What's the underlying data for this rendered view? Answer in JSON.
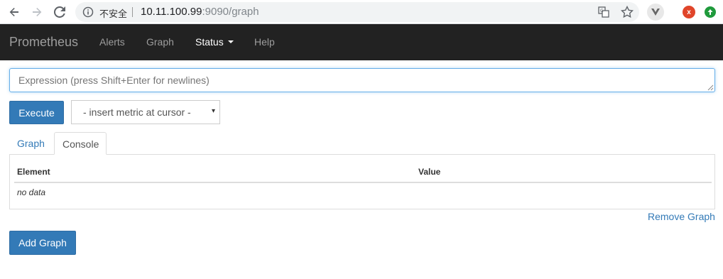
{
  "browser": {
    "insecure_label": "不安全",
    "url_host": "10.11.100.99",
    "url_path": ":9090/graph",
    "ext_x_label": "x"
  },
  "navbar": {
    "brand": "Prometheus",
    "items": [
      {
        "label": "Alerts"
      },
      {
        "label": "Graph"
      },
      {
        "label": "Status"
      },
      {
        "label": "Help"
      }
    ]
  },
  "expression": {
    "placeholder": "Expression (press Shift+Enter for newlines)",
    "value": ""
  },
  "execute_label": "Execute",
  "metric_select": {
    "selected": "- insert metric at cursor -",
    "arrow": "▾"
  },
  "tabs": [
    {
      "label": "Graph",
      "active": false
    },
    {
      "label": "Console",
      "active": true
    }
  ],
  "console_table": {
    "headers": [
      "Element",
      "Value"
    ],
    "empty_text": "no data"
  },
  "remove_graph_label": "Remove Graph",
  "add_graph_label": "Add Graph"
}
